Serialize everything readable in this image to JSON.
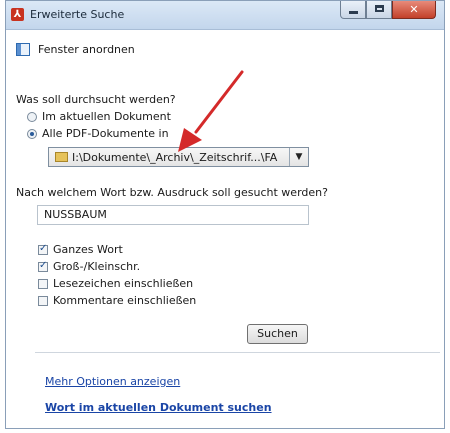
{
  "window": {
    "title": "Erweiterte Suche",
    "app_icon": "acrobat-icon",
    "controls": [
      "minimize-icon",
      "maximize-icon",
      "close-icon"
    ]
  },
  "arrange": {
    "label": "Fenster anordnen",
    "icon": "window-arrange-icon"
  },
  "scope": {
    "question": "Was soll durchsucht werden?",
    "options": [
      {
        "label": "Im aktuellen Dokument",
        "selected": false
      },
      {
        "label": "Alle PDF-Dokumente in",
        "selected": true
      }
    ],
    "folder_path": "I:\\Dokumente\\_Archiv\\_Zeitschrif...\\FA"
  },
  "query": {
    "question": "Nach welchem Wort bzw. Ausdruck soll gesucht werden?",
    "value": "NUSSBAUM"
  },
  "options": [
    {
      "label": "Ganzes Wort",
      "checked": true
    },
    {
      "label": "Groß-/Kleinschr.",
      "checked": true
    },
    {
      "label": "Lesezeichen einschließen",
      "checked": false
    },
    {
      "label": "Kommentare einschließen",
      "checked": false
    }
  ],
  "search_button": "Suchen",
  "links": {
    "more_options": "Mehr Optionen anzeigen",
    "search_current": "Wort im aktuellen Dokument suchen"
  },
  "colors": {
    "annotation_arrow": "#d42a2a",
    "link": "#1a45a6"
  }
}
